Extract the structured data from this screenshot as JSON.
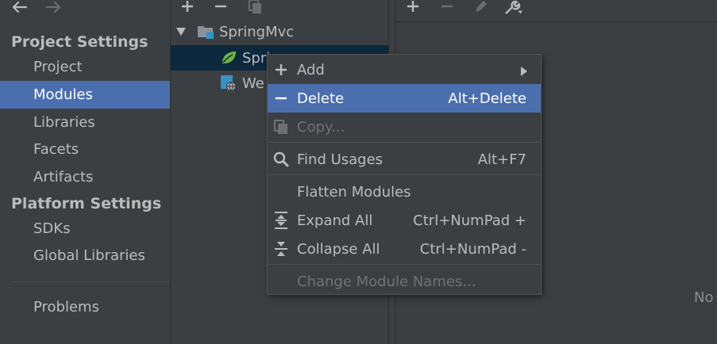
{
  "left": {
    "project_settings_header": "Project Settings",
    "platform_settings_header": "Platform Settings",
    "project_items": [
      "Project",
      "Modules",
      "Libraries",
      "Facets",
      "Artifacts"
    ],
    "platform_items": [
      "SDKs",
      "Global Libraries"
    ],
    "problems_label": "Problems",
    "selected_item": "Modules"
  },
  "tree": {
    "root_label": "SpringMvc",
    "child1_label": "Spri",
    "child2_label": "We"
  },
  "detail": {
    "placeholder_text": "No"
  },
  "menu": {
    "items": {
      "add": {
        "label": "Add",
        "shortcut": ""
      },
      "delete": {
        "label": "Delete",
        "shortcut": "Alt+Delete"
      },
      "copy": {
        "label": "Copy...",
        "shortcut": ""
      },
      "find_usages": {
        "label": "Find Usages",
        "shortcut": "Alt+F7"
      },
      "flatten_modules": {
        "label": "Flatten Modules",
        "shortcut": ""
      },
      "expand_all": {
        "label": "Expand All",
        "shortcut": "Ctrl+NumPad +"
      },
      "collapse_all": {
        "label": "Collapse All",
        "shortcut": "Ctrl+NumPad -"
      },
      "change_names": {
        "label": "Change Module Names...",
        "shortcut": ""
      }
    }
  },
  "colors": {
    "background": "#3c3f41",
    "selection": "#4b6eaf",
    "tree_selection": "#0d293e",
    "text": "#bbbbbb",
    "disabled_text": "#6f7173",
    "spring_green": "#6db33f"
  }
}
